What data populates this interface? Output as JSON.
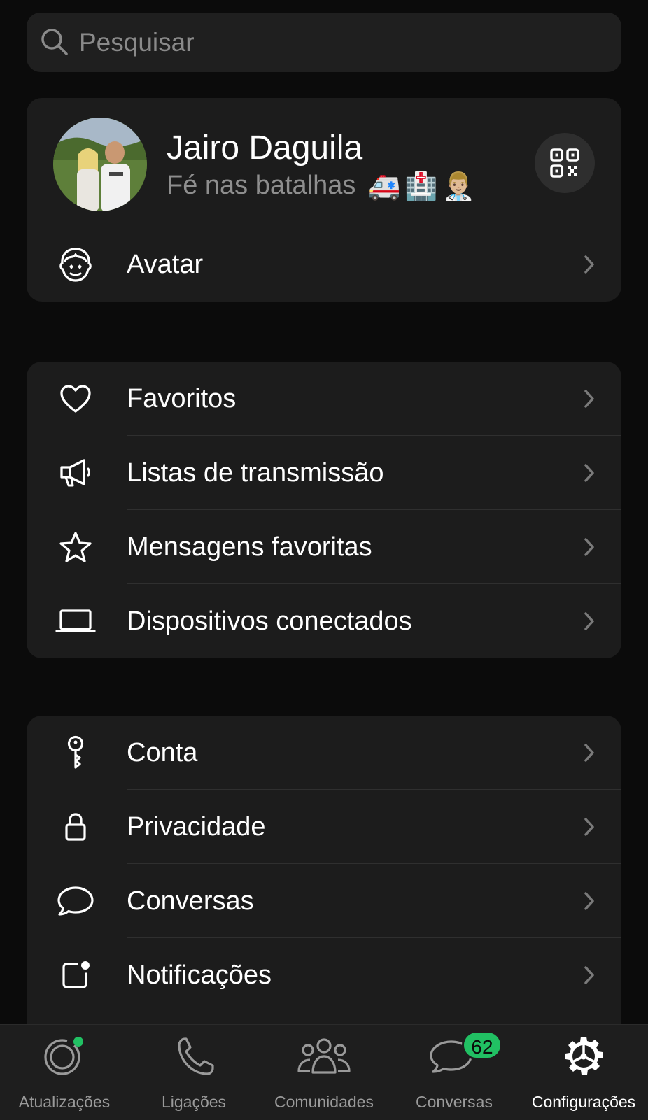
{
  "search": {
    "placeholder": "Pesquisar"
  },
  "profile": {
    "name": "Jairo Daguila",
    "status": "Fé nas batalhas",
    "status_emojis": [
      "🚑",
      "🏥",
      "👨🏼‍⚕️"
    ]
  },
  "avatar_row": {
    "label": "Avatar"
  },
  "group1": {
    "items": [
      {
        "label": "Favoritos",
        "icon": "heart-icon"
      },
      {
        "label": "Listas de transmissão",
        "icon": "megaphone-icon"
      },
      {
        "label": "Mensagens favoritas",
        "icon": "star-icon"
      },
      {
        "label": "Dispositivos conectados",
        "icon": "laptop-icon"
      }
    ]
  },
  "group2": {
    "items": [
      {
        "label": "Conta",
        "icon": "key-icon"
      },
      {
        "label": "Privacidade",
        "icon": "lock-icon"
      },
      {
        "label": "Conversas",
        "icon": "chat-bubble-icon"
      },
      {
        "label": "Notificações",
        "icon": "notification-icon"
      }
    ]
  },
  "tabbar": {
    "tabs": [
      {
        "label": "Atualizações",
        "icon": "updates-icon"
      },
      {
        "label": "Ligações",
        "icon": "phone-icon"
      },
      {
        "label": "Comunidades",
        "icon": "communities-icon"
      },
      {
        "label": "Conversas",
        "icon": "chats-icon",
        "badge": "62"
      },
      {
        "label": "Configurações",
        "icon": "settings-icon",
        "active": true
      }
    ]
  },
  "colors": {
    "background": "#0b0b0b",
    "card": "#1c1c1c",
    "accent_green": "#21c063",
    "secondary_text": "#8e8e8e"
  }
}
